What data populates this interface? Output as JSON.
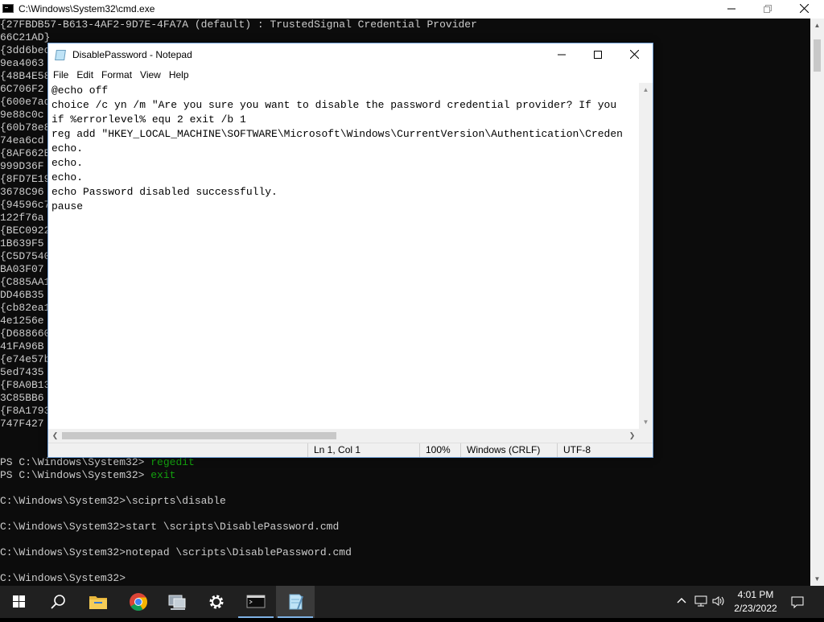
{
  "cmd": {
    "title": "C:\\Windows\\System32\\cmd.exe",
    "lines": [
      "{27FBDB57-B613-4AF2-9D7E-4FA7A (default) : TrustedSignal Credential Provider",
      "66C21AD}",
      "{3dd6bec",
      "9ea4063",
      "{48B4E58",
      "6C706F2",
      "{600e7ad",
      "9e88c0c",
      "{60b78e8",
      "74ea6cd",
      "{8AF662B",
      "999D36F",
      "{8FD7E19",
      "3678C96",
      "{94596c7",
      "122f76a",
      "{BEC0922",
      "1B639F5",
      "{C5D7540",
      "BA03F07",
      "{C885AA1",
      "DD46B35",
      "{cb82ea1",
      "4e1256e",
      "{D688660",
      "41FA96B",
      "{e74e57b",
      "5ed7435",
      "{F8A0B13",
      "3C85BB6",
      "{F8A1793",
      "747F427"
    ],
    "prompt_lines": [
      {
        "prefix": "PS C:\\Windows\\System32> ",
        "cmd": "regedit"
      },
      {
        "prefix": "PS C:\\Windows\\System32> ",
        "cmd": "exit"
      },
      {
        "prefix": "",
        "cmd": ""
      },
      {
        "prefix": "C:\\Windows\\System32>\\sciprts\\disable",
        "cmd": ""
      },
      {
        "prefix": "",
        "cmd": ""
      },
      {
        "prefix": "C:\\Windows\\System32>start \\scripts\\DisablePassword.cmd",
        "cmd": ""
      },
      {
        "prefix": "",
        "cmd": ""
      },
      {
        "prefix": "C:\\Windows\\System32>notepad \\scripts\\DisablePassword.cmd",
        "cmd": ""
      },
      {
        "prefix": "",
        "cmd": ""
      },
      {
        "prefix": "C:\\Windows\\System32>",
        "cmd": ""
      }
    ]
  },
  "notepad": {
    "title": "DisablePassword - Notepad",
    "menu": [
      "File",
      "Edit",
      "Format",
      "View",
      "Help"
    ],
    "lines": [
      "@echo off",
      "choice /c yn /m \"Are you sure you want to disable the password credential provider? If you",
      "if %errorlevel% equ 2 exit /b 1",
      "reg add \"HKEY_LOCAL_MACHINE\\SOFTWARE\\Microsoft\\Windows\\CurrentVersion\\Authentication\\Creden",
      "echo.",
      "echo.",
      "echo.",
      "echo Password disabled successfully.",
      "pause"
    ],
    "status": {
      "position": "Ln 1, Col 1",
      "zoom": "100%",
      "line_ending": "Windows (CRLF)",
      "encoding": "UTF-8"
    }
  },
  "taskbar": {
    "time": "4:01 PM",
    "date": "2/23/2022"
  }
}
